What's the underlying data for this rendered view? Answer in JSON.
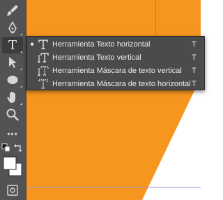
{
  "colors": {
    "document_orange": "#F7961F",
    "toolbar_bg": "#535353",
    "menu_bg": "#4b4b4b",
    "menu_text": "#ececec"
  },
  "toolbar": {
    "tools": [
      {
        "icon": "brush-icon"
      },
      {
        "icon": "pen-icon"
      },
      {
        "icon": "type-tool-icon",
        "label": "T",
        "active": true
      },
      {
        "icon": "selection-arrow-icon"
      },
      {
        "icon": "ellipse-icon"
      },
      {
        "icon": "hand-icon"
      },
      {
        "icon": "zoom-icon"
      },
      {
        "icon": "more-tools-icon",
        "label": "•••"
      },
      {
        "icon": "default-colors-icon"
      },
      {
        "icon": "swap-colors-icon"
      },
      {
        "icon": "color-swatches-icon"
      },
      {
        "icon": "screen-mode-icon"
      }
    ]
  },
  "flyout": {
    "items": [
      {
        "label": "Herramienta Texto horizontal",
        "shortcut": "T",
        "checked": "■",
        "icon": "horizontal-type-icon"
      },
      {
        "label": "Herramienta Texto vertical",
        "shortcut": "T",
        "checked": "",
        "icon": "vertical-type-icon"
      },
      {
        "label": "Herramienta Máscara de texto vertical",
        "shortcut": "T",
        "checked": "",
        "icon": "vertical-type-mask-icon"
      },
      {
        "label": "Herramienta Máscara de texto horizontal",
        "shortcut": "T",
        "checked": "",
        "icon": "horizontal-type-mask-icon"
      }
    ]
  }
}
